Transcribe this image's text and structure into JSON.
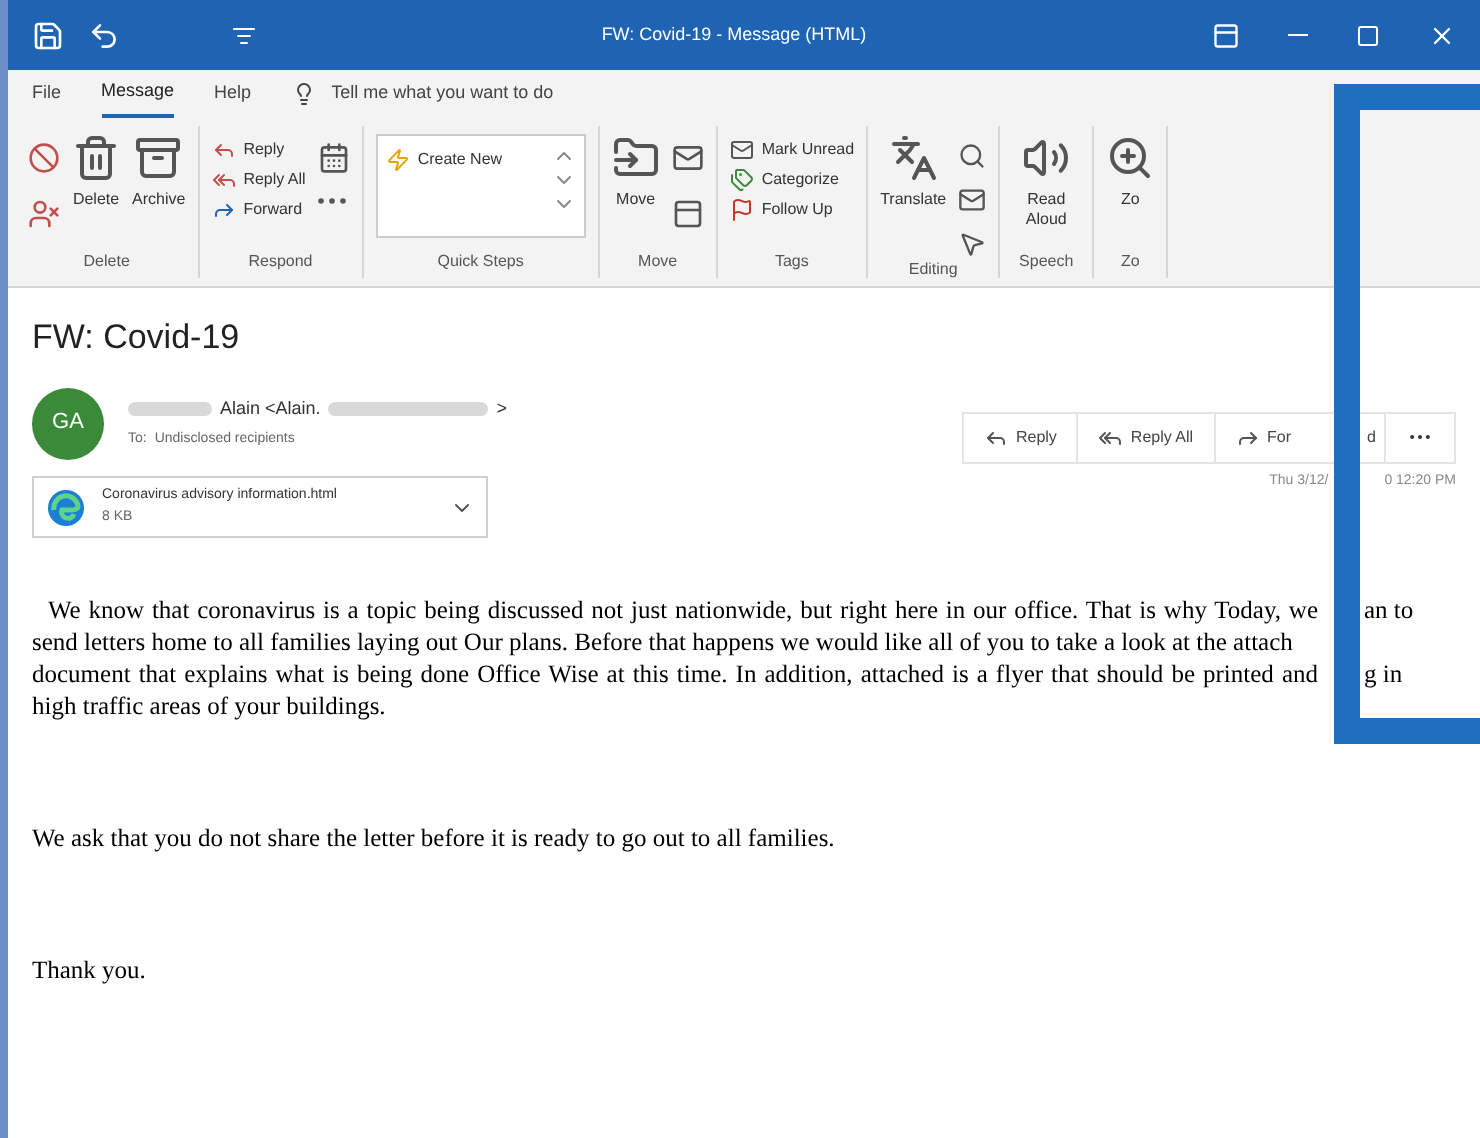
{
  "window": {
    "title": "FW: Covid-19  -  Message (HTML)"
  },
  "menu_tabs": [
    {
      "label": "File",
      "selected": false
    },
    {
      "label": "Message",
      "selected": true
    },
    {
      "label": "Help",
      "selected": false
    }
  ],
  "tell_me": {
    "placeholder": "Tell me what you want to do"
  },
  "ribbon": {
    "delete_group": {
      "label": "Delete",
      "delete": "Delete",
      "archive": "Archive"
    },
    "respond_group": {
      "label": "Respond",
      "reply": "Reply",
      "reply_all": "Reply All",
      "forward": "Forward"
    },
    "quick_steps_group": {
      "label": "Quick Steps",
      "create_new": "Create New"
    },
    "move_group": {
      "label": "Move",
      "move": "Move"
    },
    "tags_group": {
      "label": "Tags",
      "mark_unread": "Mark Unread",
      "categorize": "Categorize",
      "follow_up": "Follow Up"
    },
    "editing_group": {
      "label": "Editing",
      "translate": "Translate"
    },
    "speech_group": {
      "label": "Speech",
      "read_aloud": "Read Aloud"
    },
    "zoom_group": {
      "label": "Zo",
      "zoom": "Zo"
    }
  },
  "message": {
    "subject": "FW: Covid-19",
    "avatar": "GA",
    "sender": "Alain <Alain.",
    "sender_end": ">",
    "to_label": "To:",
    "to": "Undisclosed recipients",
    "actions": [
      {
        "label": "Reply"
      },
      {
        "label": "Reply All"
      },
      {
        "label": "For",
        "after": "d"
      }
    ],
    "date": {
      "label": "Thu 3/12/",
      "after": "0 12:20 PM"
    },
    "attachment": {
      "name": "Coronavirus advisory information.html",
      "size": "8 KB"
    },
    "body": [
      {
        "lines": [
          {
            "text": "We know that coronavirus is a topic being discussed not just nationwide, but right here in our office. That is why Today, we",
            "after": "an to"
          },
          {
            "text": "send letters home to all families laying out Our plans. Before that happens we would like all of you to take a look at the attach"
          },
          {
            "text": "document that explains what is being done Office Wise at this time. In addition, attached is a flyer that should be printed and",
            "after": "g in"
          },
          {
            "text": "high traffic areas of your buildings."
          }
        ]
      },
      {
        "lines": [
          {
            "text": "We ask that you do not share the letter before it is ready to go out to all families."
          }
        ]
      },
      {
        "lines": [
          {
            "text": "Thank you."
          }
        ]
      }
    ]
  }
}
